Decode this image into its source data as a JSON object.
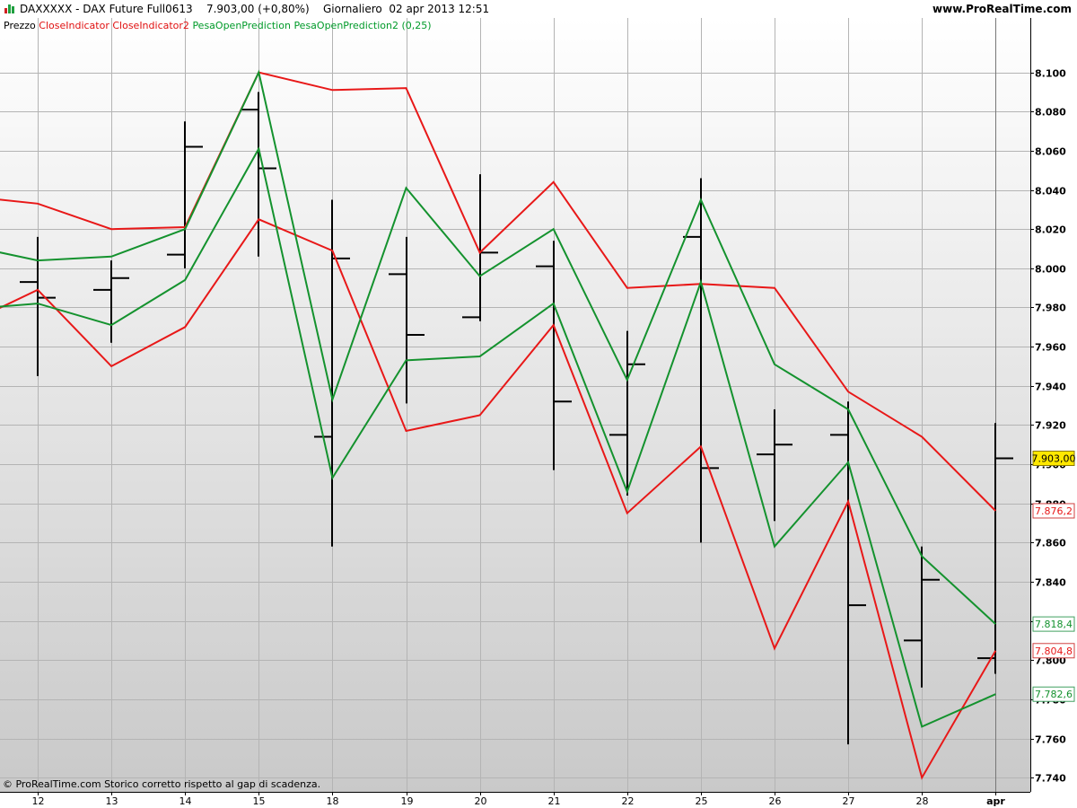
{
  "header": {
    "instrument": "DAXXXXX - DAX Future Full0613",
    "price_change": "7.903,00 (+0,80%)",
    "period": "Giornaliero",
    "datetime": "02 apr 2013 12:51",
    "site": "www.ProRealTime.com"
  },
  "legend": {
    "price_label": "Prezzo",
    "red_label": "CloseIndicator CloseIndicator2",
    "green_label": "PesaOpenPrediction PesaOpenPrediction2 (0,25)"
  },
  "footer": {
    "note": "© ProRealTime.com  Storico corretto rispetto al gap di scadenza."
  },
  "colors": {
    "red": "#e81818",
    "green": "#14922e",
    "price": "#000000",
    "current_price_bg": "#ffe800"
  },
  "chart_data": {
    "type": "line",
    "x": [
      "12",
      "13",
      "14",
      "15",
      "18",
      "19",
      "20",
      "21",
      "22",
      "25",
      "26",
      "27",
      "28",
      "apr"
    ],
    "ylim": [
      7730,
      8120
    ],
    "y_ticks": [
      7740,
      7760,
      7780,
      7800,
      7820,
      7840,
      7860,
      7880,
      7900,
      7920,
      7940,
      7960,
      7980,
      8000,
      8020,
      8040,
      8060,
      8080,
      8100
    ],
    "y_tick_labels": [
      "7.740",
      "7.760",
      "7.780",
      "7.800",
      "7.820",
      "7.840",
      "7.860",
      "7.880",
      "7.900",
      "7.920",
      "7.940",
      "7.960",
      "7.980",
      "8.000",
      "8.020",
      "8.040",
      "8.060",
      "8.080",
      "8.100"
    ],
    "grid": true,
    "price_bars": [
      {
        "x": "12",
        "open": 7993,
        "high": 8016,
        "low": 7945,
        "close": 7985
      },
      {
        "x": "13",
        "open": 7989,
        "high": 8004,
        "low": 7962,
        "close": 7995
      },
      {
        "x": "14",
        "open": 8007,
        "high": 8075,
        "low": 8000,
        "close": 8062
      },
      {
        "x": "15",
        "open": 8081,
        "high": 8090,
        "low": 8006,
        "close": 8051
      },
      {
        "x": "18",
        "open": 7914,
        "high": 8035,
        "low": 7858,
        "close": 8005
      },
      {
        "x": "19",
        "open": 7997,
        "high": 8016,
        "low": 7931,
        "close": 7966
      },
      {
        "x": "20",
        "open": 7975,
        "high": 8048,
        "low": 7973,
        "close": 8008
      },
      {
        "x": "21",
        "open": 8001,
        "high": 8014,
        "low": 7897,
        "close": 7932
      },
      {
        "x": "22",
        "open": 7915,
        "high": 7968,
        "low": 7884,
        "close": 7951
      },
      {
        "x": "25",
        "open": 8016,
        "high": 8046,
        "low": 7860,
        "close": 7898
      },
      {
        "x": "26",
        "open": 7905,
        "high": 7928,
        "low": 7871,
        "close": 7910
      },
      {
        "x": "27",
        "open": 7915,
        "high": 7932,
        "low": 7757,
        "close": 7828
      },
      {
        "x": "28",
        "open": 7810,
        "high": 7858,
        "low": 7786,
        "close": 7841
      },
      {
        "x": "apr",
        "open": 7801,
        "high": 7921,
        "low": 7793,
        "close": 7903
      }
    ],
    "series": [
      {
        "color": "#e81818",
        "x_start": -1,
        "values": [
          8037,
          8033,
          8020,
          8021,
          8100,
          8091,
          8092,
          8008,
          8044,
          7990,
          7992,
          7990,
          7937,
          7914,
          7876.2
        ]
      },
      {
        "color": "#e81818",
        "x_start": -1,
        "values": [
          7971,
          7989,
          7950,
          7970,
          8025,
          8009,
          7917,
          7925,
          7971,
          7875,
          7909,
          7806,
          7881,
          7740,
          7804.8
        ]
      },
      {
        "color": "#14922e",
        "x_start": -1,
        "values": [
          8012,
          8004,
          8006,
          8020,
          8100,
          7933,
          8041,
          7996,
          8020,
          7943,
          8035,
          7951,
          7928,
          7853,
          7818.4
        ]
      },
      {
        "color": "#14922e",
        "x_start": -1,
        "values": [
          7979,
          7982,
          7971,
          7994,
          8061,
          7893,
          7953,
          7955,
          7982,
          7886,
          7993,
          7858,
          7901,
          7766,
          7782.6
        ]
      }
    ],
    "value_labels": [
      {
        "text": "7.903,00",
        "value": 7903,
        "style": "price"
      },
      {
        "text": "7.876,2",
        "value": 7876.2,
        "style": "red"
      },
      {
        "text": "7.818,4",
        "value": 7818.4,
        "style": "green"
      },
      {
        "text": "7.804,8",
        "value": 7804.8,
        "style": "red"
      },
      {
        "text": "7.782,6",
        "value": 7782.6,
        "style": "green"
      }
    ]
  }
}
